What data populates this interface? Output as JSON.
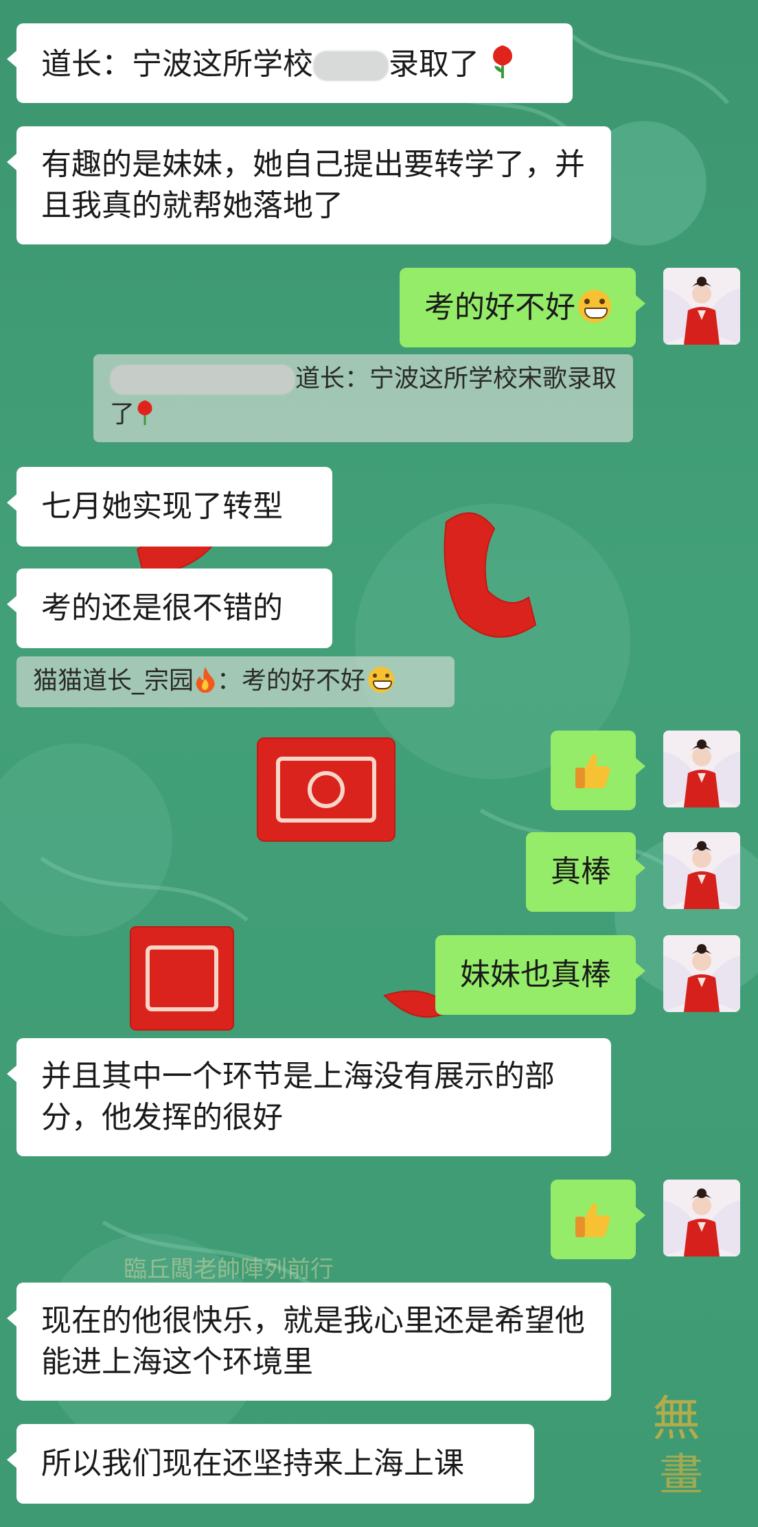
{
  "messages": [
    {
      "side": "left",
      "pre": "道长：宁波这所学校",
      "post": "录取了"
    },
    {
      "side": "left",
      "text": "有趣的是妹妹，她自己提出要转学了，并且我真的就帮她落地了"
    },
    {
      "side": "right",
      "text": "考的好不好"
    },
    {
      "quote_text": "道长：宁波这所学校宋歌录取了"
    },
    {
      "side": "left",
      "text": "七月她实现了转型"
    },
    {
      "side": "left",
      "text": "考的还是很不错的"
    },
    {
      "quote_text_a": "猫猫道长_宗园",
      "quote_text_b": "：考的好不好"
    },
    {
      "side": "right",
      "emoji": "thumbs-up"
    },
    {
      "side": "right",
      "text": "真棒"
    },
    {
      "side": "right",
      "text": "妹妹也真棒"
    },
    {
      "side": "left",
      "text": "并且其中一个环节是上海没有展示的部分，他发挥的很好"
    },
    {
      "side": "right",
      "emoji": "thumbs-up"
    },
    {
      "side": "left",
      "text": "现在的他很快乐，就是我心里还是希望他能进上海这个环境里"
    },
    {
      "side": "left",
      "text": "所以我们现在还坚持来上海上课"
    }
  ],
  "background_text": "臨丘闆老帥陣列前行",
  "colors": {
    "bubble_self": "#95ec69",
    "bubble_other": "#ffffff",
    "background": "#3f9a72",
    "accent_red": "#d9231c"
  }
}
